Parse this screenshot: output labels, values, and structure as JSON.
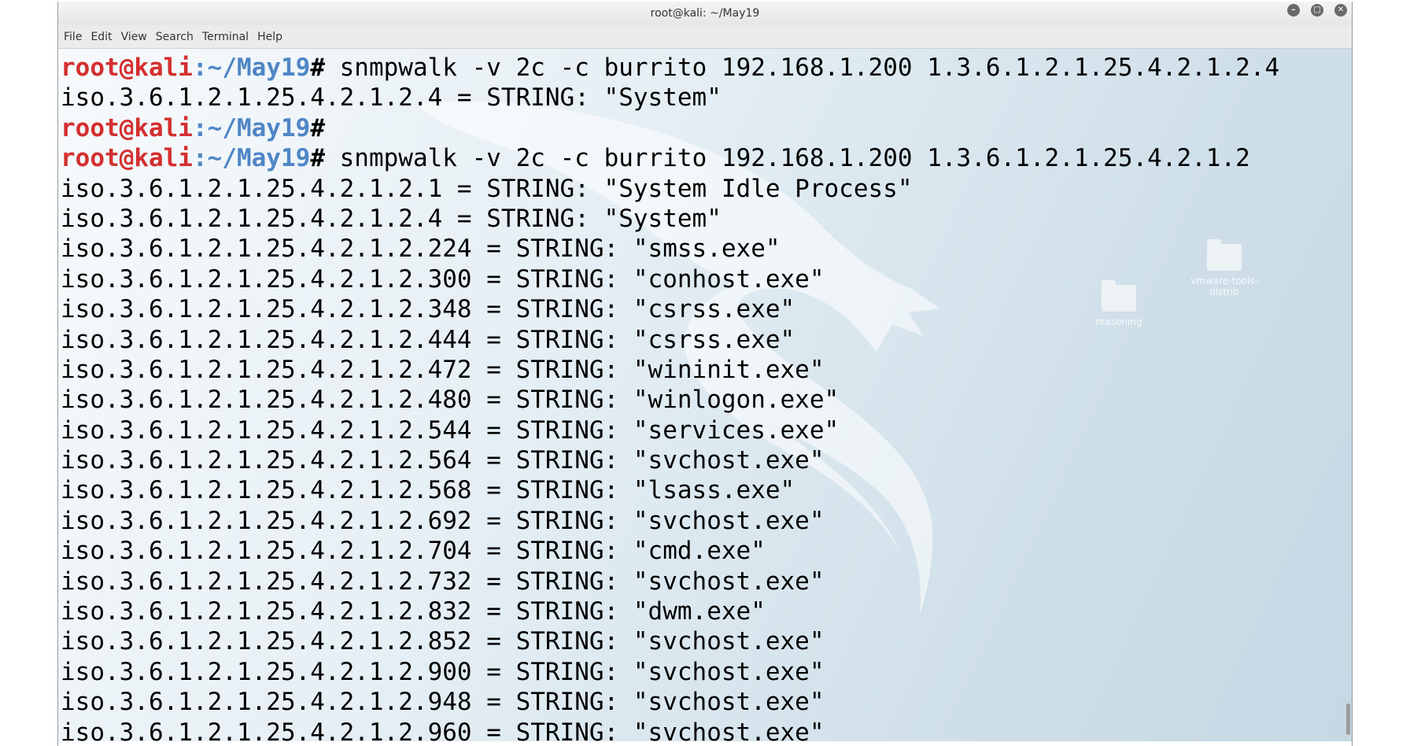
{
  "window": {
    "title": "root@kali: ~/May19",
    "controls": {
      "minimize_icon": "minimize-icon",
      "maximize_icon": "maximize-icon",
      "close_icon": "close-icon"
    }
  },
  "menu": {
    "items": [
      "File",
      "Edit",
      "View",
      "Search",
      "Terminal",
      "Help"
    ]
  },
  "desktop": {
    "icons": [
      {
        "label": "reasoning",
        "icon": "folder-icon"
      },
      {
        "label_line1": "vmware-tools-",
        "label_line2": "distrib",
        "icon": "folder-icon"
      }
    ]
  },
  "terminal": {
    "prompt": {
      "user_host": "root@kali",
      "separator": ":",
      "path": "~/May19",
      "symbol": "#"
    },
    "colors": {
      "user_host": "#d42f2f",
      "path": "#4f86c6",
      "text": "#000000"
    },
    "lines": [
      {
        "type": "prompt",
        "command": " snmpwalk -v 2c -c burrito 192.168.1.200 1.3.6.1.2.1.25.4.2.1.2.4"
      },
      {
        "type": "output",
        "text": "iso.3.6.1.2.1.25.4.2.1.2.4 = STRING: \"System\""
      },
      {
        "type": "prompt",
        "command": ""
      },
      {
        "type": "prompt",
        "command": " snmpwalk -v 2c -c burrito 192.168.1.200 1.3.6.1.2.1.25.4.2.1.2"
      },
      {
        "type": "output",
        "text": "iso.3.6.1.2.1.25.4.2.1.2.1 = STRING: \"System Idle Process\""
      },
      {
        "type": "output",
        "text": "iso.3.6.1.2.1.25.4.2.1.2.4 = STRING: \"System\""
      },
      {
        "type": "output",
        "text": "iso.3.6.1.2.1.25.4.2.1.2.224 = STRING: \"smss.exe\""
      },
      {
        "type": "output",
        "text": "iso.3.6.1.2.1.25.4.2.1.2.300 = STRING: \"conhost.exe\""
      },
      {
        "type": "output",
        "text": "iso.3.6.1.2.1.25.4.2.1.2.348 = STRING: \"csrss.exe\""
      },
      {
        "type": "output",
        "text": "iso.3.6.1.2.1.25.4.2.1.2.444 = STRING: \"csrss.exe\""
      },
      {
        "type": "output",
        "text": "iso.3.6.1.2.1.25.4.2.1.2.472 = STRING: \"wininit.exe\""
      },
      {
        "type": "output",
        "text": "iso.3.6.1.2.1.25.4.2.1.2.480 = STRING: \"winlogon.exe\""
      },
      {
        "type": "output",
        "text": "iso.3.6.1.2.1.25.4.2.1.2.544 = STRING: \"services.exe\""
      },
      {
        "type": "output",
        "text": "iso.3.6.1.2.1.25.4.2.1.2.564 = STRING: \"svchost.exe\""
      },
      {
        "type": "output",
        "text": "iso.3.6.1.2.1.25.4.2.1.2.568 = STRING: \"lsass.exe\""
      },
      {
        "type": "output",
        "text": "iso.3.6.1.2.1.25.4.2.1.2.692 = STRING: \"svchost.exe\""
      },
      {
        "type": "output",
        "text": "iso.3.6.1.2.1.25.4.2.1.2.704 = STRING: \"cmd.exe\""
      },
      {
        "type": "output",
        "text": "iso.3.6.1.2.1.25.4.2.1.2.732 = STRING: \"svchost.exe\""
      },
      {
        "type": "output",
        "text": "iso.3.6.1.2.1.25.4.2.1.2.832 = STRING: \"dwm.exe\""
      },
      {
        "type": "output",
        "text": "iso.3.6.1.2.1.25.4.2.1.2.852 = STRING: \"svchost.exe\""
      },
      {
        "type": "output",
        "text": "iso.3.6.1.2.1.25.4.2.1.2.900 = STRING: \"svchost.exe\""
      },
      {
        "type": "output",
        "text": "iso.3.6.1.2.1.25.4.2.1.2.948 = STRING: \"svchost.exe\""
      },
      {
        "type": "output",
        "text": "iso.3.6.1.2.1.25.4.2.1.2.960 = STRING: \"svchost.exe\""
      }
    ]
  }
}
